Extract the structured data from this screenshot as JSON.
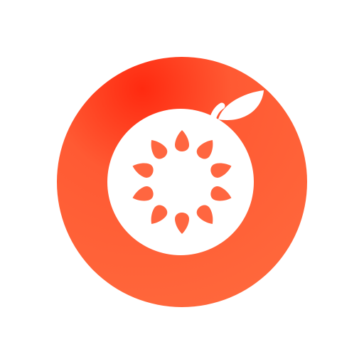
{
  "icon": {
    "name": "fruit-slice-logo-icon",
    "colors": {
      "background": "#ffffff",
      "ring_highlight": "#ff2a10",
      "ring_main": "#ff5a33",
      "ring_edge": "#ff6a3d",
      "fruit": "#ffffff",
      "seeds": "#ff6640"
    },
    "seed_count": 10
  }
}
